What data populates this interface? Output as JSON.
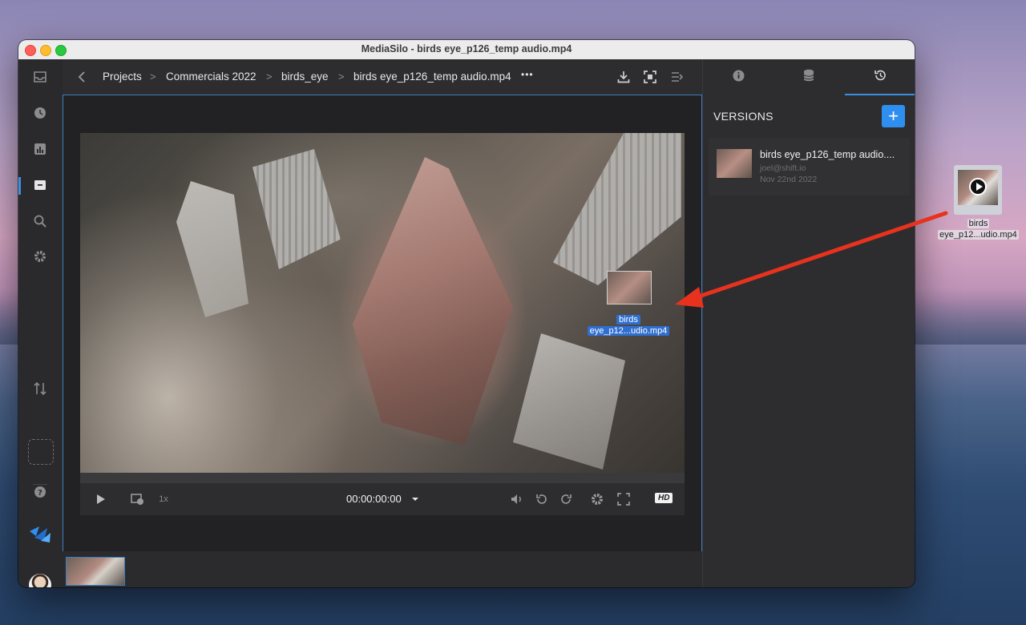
{
  "window": {
    "title": "MediaSilo - birds eye_p126_temp audio.mp4"
  },
  "breadcrumb": {
    "items": [
      "Projects",
      "Commercials 2022",
      "birds_eye",
      "birds eye_p126_temp audio.mp4"
    ],
    "separator": ">",
    "more": "•••"
  },
  "player": {
    "speed": "1x",
    "timecode": "00:00:00:00",
    "quality_badge": "HD"
  },
  "drag_preview": {
    "label_line1": "birds",
    "label_line2": "eye_p12...udio.mp4"
  },
  "versions_panel": {
    "title": "VERSIONS",
    "add_label": "+",
    "versions": [
      {
        "name": "birds eye_p126_temp audio....",
        "user": "joel@shift.io",
        "date": "Nov 22nd 2022"
      }
    ]
  },
  "desktop_file": {
    "label_line1": "birds",
    "label_line2": "eye_p12...udio.mp4"
  },
  "colors": {
    "accent": "#2f8ff0",
    "annotation_arrow": "#e8321e",
    "selection": "#2f6fd0"
  }
}
